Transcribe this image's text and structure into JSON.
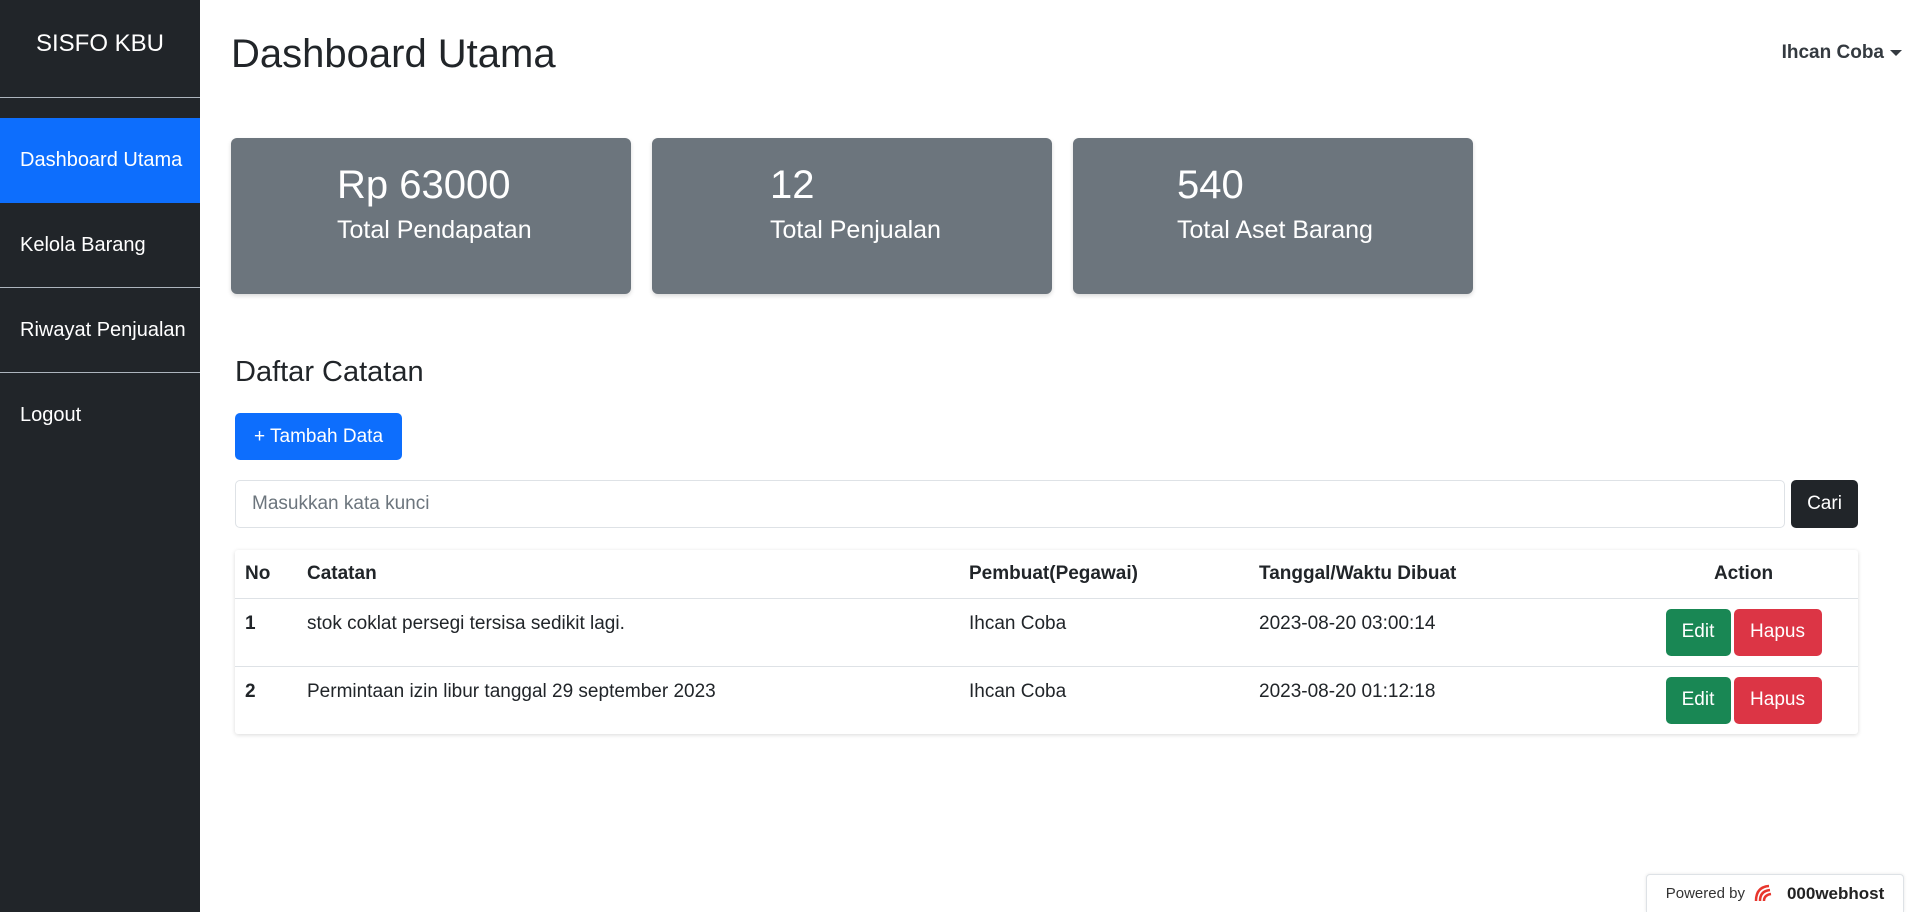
{
  "sidebar": {
    "brand": "SISFO KBU",
    "items": [
      {
        "label": "Dashboard Utama"
      },
      {
        "label": "Kelola Barang"
      },
      {
        "label": "Riwayat Penjualan"
      },
      {
        "label": "Logout"
      }
    ]
  },
  "header": {
    "title": "Dashboard Utama",
    "user": "Ihcan Coba"
  },
  "cards": [
    {
      "value": "Rp 63000",
      "label": "Total Pendapatan"
    },
    {
      "value": "12",
      "label": "Total Penjualan"
    },
    {
      "value": "540",
      "label": "Total Aset Barang"
    }
  ],
  "notes": {
    "title": "Daftar Catatan",
    "add_label": "+ Tambah Data",
    "search_placeholder": "Masukkan kata kunci",
    "search_label": "Cari",
    "columns": [
      "No",
      "Catatan",
      "Pembuat(Pegawai)",
      "Tanggal/Waktu Dibuat",
      "Action"
    ],
    "rows": [
      {
        "no": "1",
        "note": "stok coklat persegi tersisa sedikit lagi.",
        "author": "Ihcan Coba",
        "created": "2023-08-20 03:00:14",
        "edit": "Edit",
        "delete": "Hapus"
      },
      {
        "no": "2",
        "note": "Permintaan izin libur tanggal 29 september 2023",
        "author": "Ihcan Coba",
        "created": "2023-08-20 01:12:18",
        "edit": "Edit",
        "delete": "Hapus"
      }
    ]
  },
  "footer": {
    "powered_by": "Powered by",
    "host": "000webhost"
  },
  "colors": {
    "sidebar": "#212529",
    "active": "#0d6efd",
    "card": "#6c757d",
    "edit": "#198754",
    "delete": "#dc3545"
  }
}
